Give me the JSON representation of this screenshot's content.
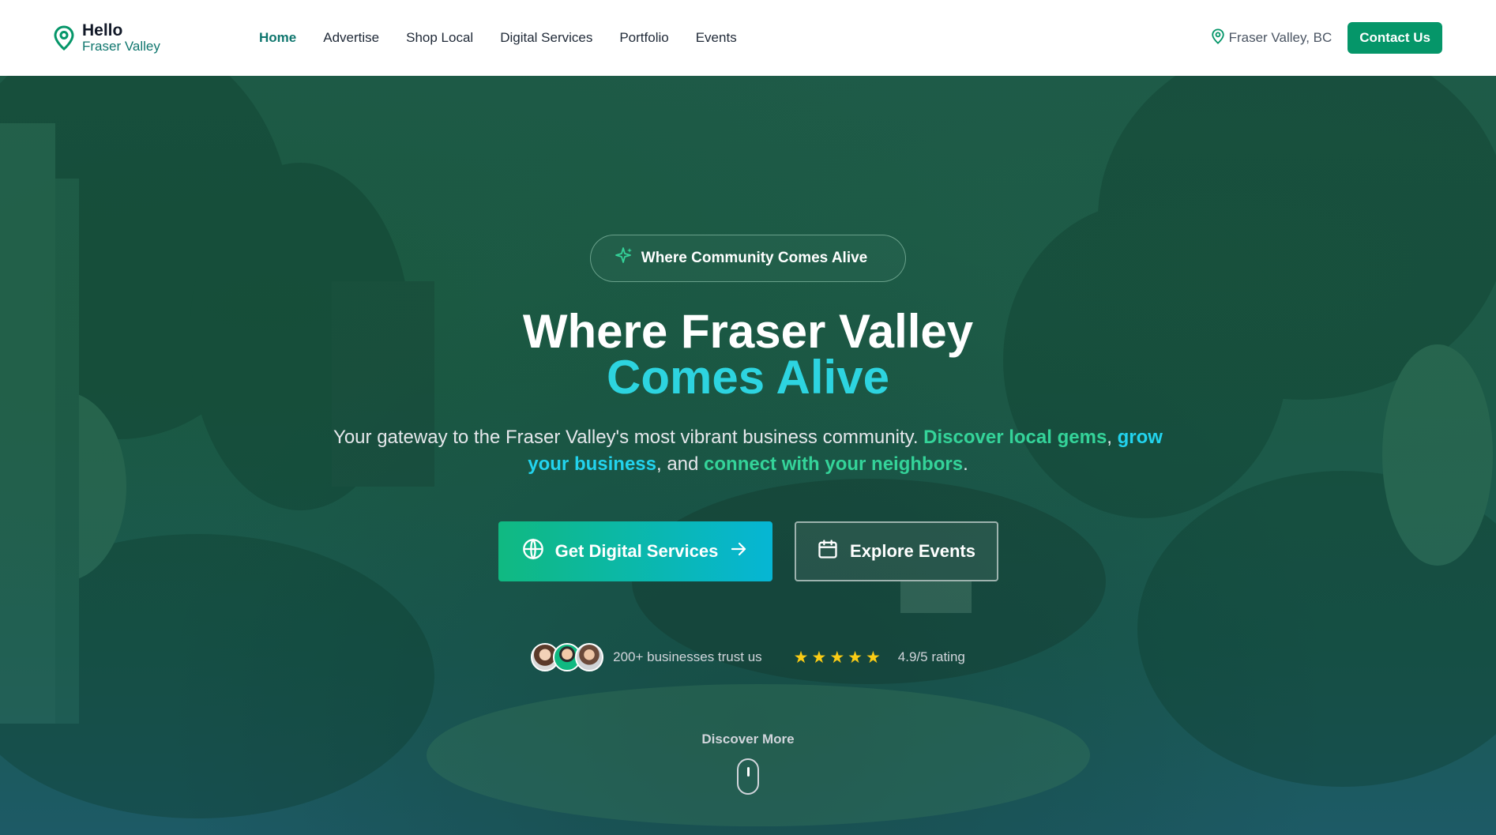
{
  "brand": {
    "line1": "Hello",
    "line2": "Fraser Valley",
    "icon": "map-pin-icon"
  },
  "nav": {
    "items": [
      {
        "label": "Home",
        "active": true
      },
      {
        "label": "Advertise",
        "active": false
      },
      {
        "label": "Shop Local",
        "active": false
      },
      {
        "label": "Digital Services",
        "active": false
      },
      {
        "label": "Portfolio",
        "active": false
      },
      {
        "label": "Events",
        "active": false
      }
    ]
  },
  "header": {
    "location": "Fraser Valley, BC",
    "location_icon": "map-pin-icon",
    "contact_label": "Contact Us"
  },
  "hero": {
    "badge": "Where Community Comes Alive",
    "badge_icon": "sparkles-icon",
    "headline_line1": "Where Fraser Valley",
    "headline_line2": "Comes Alive",
    "subtitle": {
      "part1": "Your gateway to the Fraser Valley's most vibrant business community. ",
      "highlight1": "Discover local gems",
      "part2": ", ",
      "highlight2": "grow your business",
      "part3": ", and ",
      "highlight3": "connect with your neighbors",
      "part4": "."
    },
    "primary_cta": "Get Digital Services",
    "secondary_cta": "Explore Events",
    "trust_text": "200+ businesses trust us",
    "rating_text": "4.9/5 rating",
    "stars": 5,
    "discover_label": "Discover More"
  },
  "colors": {
    "accent_green": "#059669",
    "brand_teal": "#0f766e",
    "highlight_green": "#34d399",
    "highlight_cyan": "#22d3ee",
    "star": "#facc15"
  }
}
